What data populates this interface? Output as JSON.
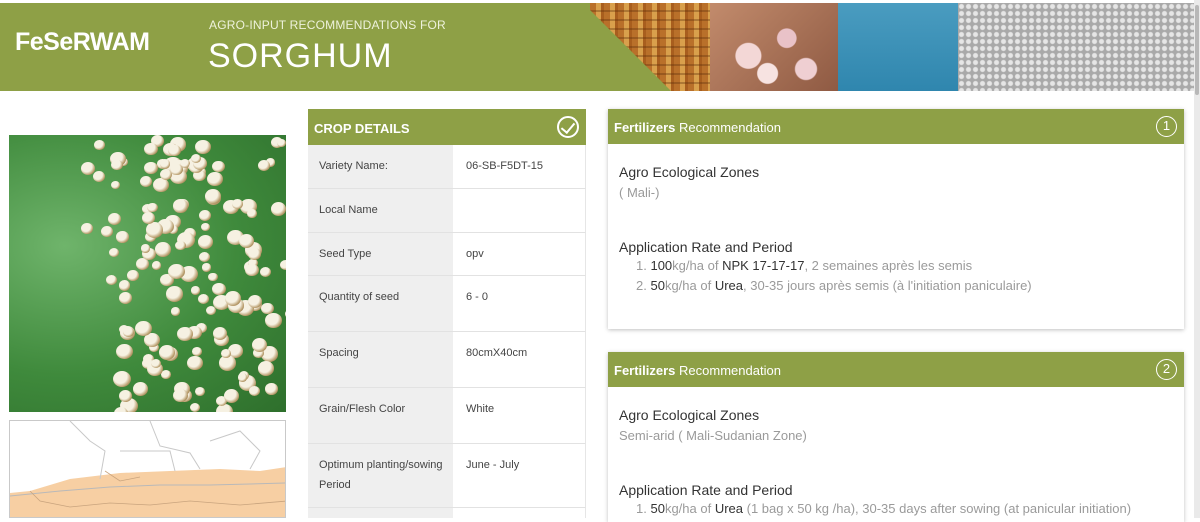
{
  "header": {
    "brand": "FeSeRWAM",
    "subtitle": "AGRO-INPUT RECOMMENDATIONS FOR",
    "crop": "SORGHUM",
    "color": "#8ea046"
  },
  "crop_details": {
    "title": "CROP DETAILS",
    "rows": [
      {
        "label": "Variety Name:",
        "value": "06-SB-F5DT-15"
      },
      {
        "label": "Local Name",
        "value": ""
      },
      {
        "label": "Seed Type",
        "value": "opv"
      },
      {
        "label": "Quantity of seed",
        "value": "6 - 0"
      },
      {
        "label": "Spacing",
        "value": "80cmX40cm"
      },
      {
        "label": "Grain/Flesh Color",
        "value": "White"
      },
      {
        "label": "Optimum planting/sowing Period",
        "value": "June - July"
      }
    ]
  },
  "recommendations": [
    {
      "title_bold": "Fertilizers",
      "title_rest": "Recommendation",
      "number": "1",
      "zones_label": "Agro Ecological Zones",
      "zone": "( Mali-)",
      "rate_label": "Application Rate and Period",
      "items": [
        {
          "index": "1.",
          "amount": "100",
          "unit": "kg/ha of",
          "product": "NPK 17-17-17",
          "period": ", 2 semaines après les semis"
        },
        {
          "index": "2.",
          "amount": "50",
          "unit": "kg/ha of",
          "product": "Urea",
          "period": ", 30-35 jours après semis (à l'initiation paniculaire)"
        }
      ]
    },
    {
      "title_bold": "Fertilizers",
      "title_rest": "Recommendation",
      "number": "2",
      "zones_label": "Agro Ecological Zones",
      "zone": "Semi-arid ( Mali-Sudanian Zone)",
      "rate_label": "Application Rate and Period",
      "items": [
        {
          "index": "1.",
          "amount": "50",
          "unit": "kg/ha of",
          "product": "Urea",
          "period": " (1 bag x 50 kg /ha), 30-35 days after sowing (at panicular initiation)"
        }
      ]
    }
  ]
}
